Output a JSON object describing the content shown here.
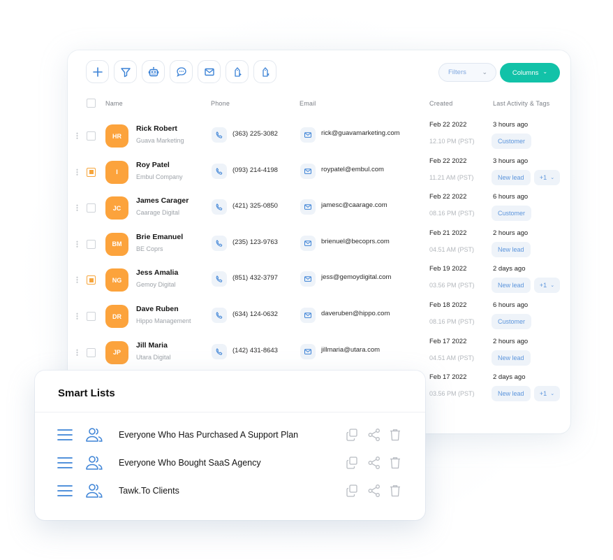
{
  "toolbar": {
    "buttons": [
      {
        "icon": "plus-icon",
        "label": "Add"
      },
      {
        "icon": "filter-icon",
        "label": "Filter"
      },
      {
        "icon": "robot-icon",
        "label": "Automation"
      },
      {
        "icon": "chat-icon",
        "label": "Message"
      },
      {
        "icon": "mail-icon",
        "label": "Email"
      },
      {
        "icon": "tag-add-icon",
        "label": "Add tag"
      },
      {
        "icon": "tag-remove-icon",
        "label": "Remove tag"
      }
    ],
    "filters_label": "Filters",
    "filters_chevron": "⌄",
    "columns_label": "Columns",
    "columns_chevron": "⌄"
  },
  "table": {
    "headers": {
      "name": "Name",
      "phone": "Phone",
      "email": "Email",
      "created": "Created",
      "activity": "Last Activity & Tags"
    },
    "rows": [
      {
        "initials": "HR",
        "name": "Rick Robert",
        "company": "Guava Marketing",
        "phone": "(363) 225-3082",
        "email": "rick@guavamarketing.com",
        "date": "Feb 22 2022",
        "time": "12.10 PM (PST)",
        "activity": "3 hours ago",
        "tag": "Customer",
        "more": "",
        "checked": false
      },
      {
        "initials": "I",
        "name": "Roy Patel",
        "company": "Embul Company",
        "phone": "(093) 214-4198",
        "email": "roypatel@embul.com",
        "date": "Feb 22 2022",
        "time": "11.21 AM (PST)",
        "activity": "3 hours ago",
        "tag": "New lead",
        "more": "+1",
        "checked": true
      },
      {
        "initials": "JC",
        "name": "James Carager",
        "company": "Caarage Digital",
        "phone": "(421) 325-0850",
        "email": "jamesc@caarage.com",
        "date": "Feb 22 2022",
        "time": "08.16 PM (PST)",
        "activity": "6 hours ago",
        "tag": "Customer",
        "more": "",
        "checked": false
      },
      {
        "initials": "BM",
        "name": "Brie Emanuel",
        "company": "BE Coprs",
        "phone": "(235) 123-9763",
        "email": "brienuel@becoprs.com",
        "date": "Feb 21 2022",
        "time": "04.51 AM (PST)",
        "activity": "2 hours ago",
        "tag": "New lead",
        "more": "",
        "checked": false
      },
      {
        "initials": "NG",
        "name": "Jess Amalia",
        "company": "Gemoy Digital",
        "phone": "(851) 432-3797",
        "email": "jess@gemoydigital.com",
        "date": "Feb 19 2022",
        "time": "03.56 PM (PST)",
        "activity": "2 days ago",
        "tag": "New lead",
        "more": "+1",
        "checked": true
      },
      {
        "initials": "DR",
        "name": "Dave Ruben",
        "company": "Hippo Management",
        "phone": "(634) 124-0632",
        "email": "daveruben@hippo.com",
        "date": "Feb 18 2022",
        "time": "08.16 PM (PST)",
        "activity": "6 hours ago",
        "tag": "Customer",
        "more": "",
        "checked": false
      },
      {
        "initials": "JP",
        "name": "Jill Maria",
        "company": "Utara Digital",
        "phone": "(142) 431-8643",
        "email": "jillmaria@utara.com",
        "date": "Feb 17 2022",
        "time": "04.51 AM (PST)",
        "activity": "2 hours ago",
        "tag": "New lead",
        "more": "",
        "checked": false
      },
      {
        "initials": "",
        "name": "",
        "company": "",
        "phone": "",
        "email": "",
        "date": "Feb 17 2022",
        "time": "03.56 PM (PST)",
        "activity": "2 days ago",
        "tag": "New lead",
        "more": "+1",
        "checked": false
      }
    ],
    "more_chevron": "⌄"
  },
  "smart_lists": {
    "title": "Smart Lists",
    "items": [
      {
        "label": "Everyone Who Has Purchased A Support Plan"
      },
      {
        "label": "Everyone Who Bought SaaS Agency"
      },
      {
        "label": "Tawk.To Clients"
      }
    ]
  },
  "colors": {
    "accent_teal": "#12c2a8",
    "avatar_orange": "#fca33c",
    "icon_blue": "#3b82d6",
    "tag_bg": "#eef3f9",
    "tag_text": "#5c95dc"
  }
}
